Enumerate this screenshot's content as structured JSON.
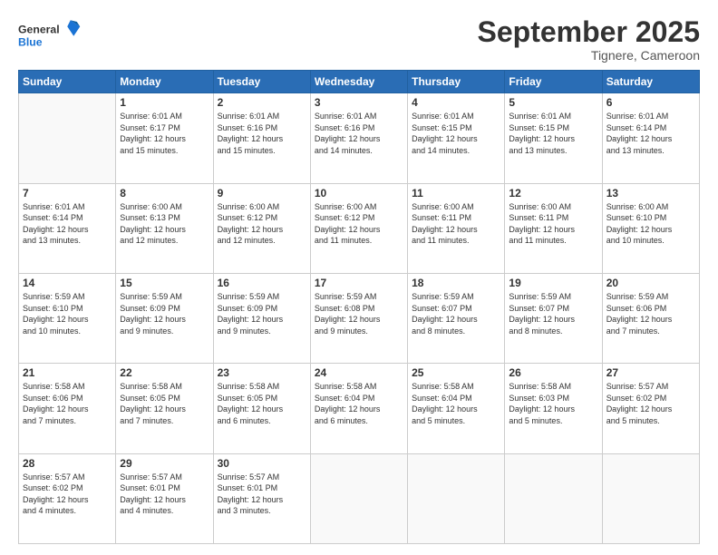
{
  "logo": {
    "line1": "General",
    "line2": "Blue"
  },
  "header": {
    "title": "September 2025",
    "subtitle": "Tignere, Cameroon"
  },
  "weekdays": [
    "Sunday",
    "Monday",
    "Tuesday",
    "Wednesday",
    "Thursday",
    "Friday",
    "Saturday"
  ],
  "weeks": [
    [
      {
        "day": "",
        "info": ""
      },
      {
        "day": "1",
        "info": "Sunrise: 6:01 AM\nSunset: 6:17 PM\nDaylight: 12 hours\nand 15 minutes."
      },
      {
        "day": "2",
        "info": "Sunrise: 6:01 AM\nSunset: 6:16 PM\nDaylight: 12 hours\nand 15 minutes."
      },
      {
        "day": "3",
        "info": "Sunrise: 6:01 AM\nSunset: 6:16 PM\nDaylight: 12 hours\nand 14 minutes."
      },
      {
        "day": "4",
        "info": "Sunrise: 6:01 AM\nSunset: 6:15 PM\nDaylight: 12 hours\nand 14 minutes."
      },
      {
        "day": "5",
        "info": "Sunrise: 6:01 AM\nSunset: 6:15 PM\nDaylight: 12 hours\nand 13 minutes."
      },
      {
        "day": "6",
        "info": "Sunrise: 6:01 AM\nSunset: 6:14 PM\nDaylight: 12 hours\nand 13 minutes."
      }
    ],
    [
      {
        "day": "7",
        "info": "Sunrise: 6:01 AM\nSunset: 6:14 PM\nDaylight: 12 hours\nand 13 minutes."
      },
      {
        "day": "8",
        "info": "Sunrise: 6:00 AM\nSunset: 6:13 PM\nDaylight: 12 hours\nand 12 minutes."
      },
      {
        "day": "9",
        "info": "Sunrise: 6:00 AM\nSunset: 6:12 PM\nDaylight: 12 hours\nand 12 minutes."
      },
      {
        "day": "10",
        "info": "Sunrise: 6:00 AM\nSunset: 6:12 PM\nDaylight: 12 hours\nand 11 minutes."
      },
      {
        "day": "11",
        "info": "Sunrise: 6:00 AM\nSunset: 6:11 PM\nDaylight: 12 hours\nand 11 minutes."
      },
      {
        "day": "12",
        "info": "Sunrise: 6:00 AM\nSunset: 6:11 PM\nDaylight: 12 hours\nand 11 minutes."
      },
      {
        "day": "13",
        "info": "Sunrise: 6:00 AM\nSunset: 6:10 PM\nDaylight: 12 hours\nand 10 minutes."
      }
    ],
    [
      {
        "day": "14",
        "info": "Sunrise: 5:59 AM\nSunset: 6:10 PM\nDaylight: 12 hours\nand 10 minutes."
      },
      {
        "day": "15",
        "info": "Sunrise: 5:59 AM\nSunset: 6:09 PM\nDaylight: 12 hours\nand 9 minutes."
      },
      {
        "day": "16",
        "info": "Sunrise: 5:59 AM\nSunset: 6:09 PM\nDaylight: 12 hours\nand 9 minutes."
      },
      {
        "day": "17",
        "info": "Sunrise: 5:59 AM\nSunset: 6:08 PM\nDaylight: 12 hours\nand 9 minutes."
      },
      {
        "day": "18",
        "info": "Sunrise: 5:59 AM\nSunset: 6:07 PM\nDaylight: 12 hours\nand 8 minutes."
      },
      {
        "day": "19",
        "info": "Sunrise: 5:59 AM\nSunset: 6:07 PM\nDaylight: 12 hours\nand 8 minutes."
      },
      {
        "day": "20",
        "info": "Sunrise: 5:59 AM\nSunset: 6:06 PM\nDaylight: 12 hours\nand 7 minutes."
      }
    ],
    [
      {
        "day": "21",
        "info": "Sunrise: 5:58 AM\nSunset: 6:06 PM\nDaylight: 12 hours\nand 7 minutes."
      },
      {
        "day": "22",
        "info": "Sunrise: 5:58 AM\nSunset: 6:05 PM\nDaylight: 12 hours\nand 7 minutes."
      },
      {
        "day": "23",
        "info": "Sunrise: 5:58 AM\nSunset: 6:05 PM\nDaylight: 12 hours\nand 6 minutes."
      },
      {
        "day": "24",
        "info": "Sunrise: 5:58 AM\nSunset: 6:04 PM\nDaylight: 12 hours\nand 6 minutes."
      },
      {
        "day": "25",
        "info": "Sunrise: 5:58 AM\nSunset: 6:04 PM\nDaylight: 12 hours\nand 5 minutes."
      },
      {
        "day": "26",
        "info": "Sunrise: 5:58 AM\nSunset: 6:03 PM\nDaylight: 12 hours\nand 5 minutes."
      },
      {
        "day": "27",
        "info": "Sunrise: 5:57 AM\nSunset: 6:02 PM\nDaylight: 12 hours\nand 5 minutes."
      }
    ],
    [
      {
        "day": "28",
        "info": "Sunrise: 5:57 AM\nSunset: 6:02 PM\nDaylight: 12 hours\nand 4 minutes."
      },
      {
        "day": "29",
        "info": "Sunrise: 5:57 AM\nSunset: 6:01 PM\nDaylight: 12 hours\nand 4 minutes."
      },
      {
        "day": "30",
        "info": "Sunrise: 5:57 AM\nSunset: 6:01 PM\nDaylight: 12 hours\nand 3 minutes."
      },
      {
        "day": "",
        "info": ""
      },
      {
        "day": "",
        "info": ""
      },
      {
        "day": "",
        "info": ""
      },
      {
        "day": "",
        "info": ""
      }
    ]
  ]
}
